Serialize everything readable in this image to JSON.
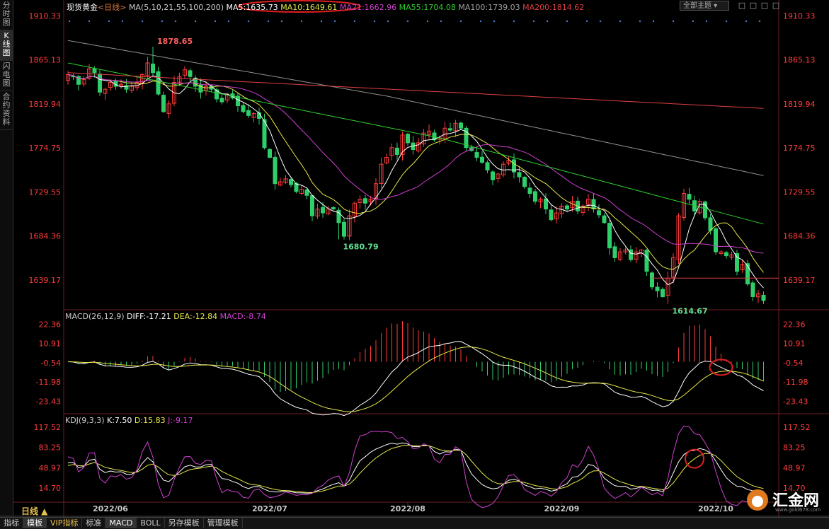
{
  "sidebar": {
    "tabs": [
      {
        "label": "分时图",
        "active": false
      },
      {
        "label": "K线图",
        "active": true
      },
      {
        "label": "闪电图",
        "active": false
      },
      {
        "label": "合约资料",
        "active": false
      }
    ]
  },
  "header": {
    "instrument": "现货黄金",
    "period": "<日线>",
    "ma_params": "MA(5,10,21,55,100,200)",
    "ma5": "MA5:1635.73",
    "ma10": "MA10:1649.61",
    "ma21": "MA21:1662.96",
    "ma55": "MA55:1704.08",
    "ma100": "MA100:1739.03",
    "ma200": "MA200:1814.62",
    "theme": "全部主题",
    "window_controls": [
      "□",
      "□",
      "□",
      "□"
    ]
  },
  "macd_header": {
    "name": "MACD(26,12,9)",
    "diff": "DIFF:-17.21",
    "dea": "DEA:-12.84",
    "macd": "MACD:-8.74"
  },
  "kdj_header": {
    "name": "KDJ(9,3,3)",
    "k": "K:7.50",
    "d": "D:15.83",
    "j": "J:-9.17"
  },
  "colors": {
    "up": "#ff3b3b",
    "down": "#2ecf6a",
    "ma5": "#ffffff",
    "ma10": "#e8e84a",
    "ma21": "#d040d0",
    "ma55": "#2ecf2e",
    "ma100": "#909090",
    "ma200": "#e04040",
    "axis_label": "#ff3b3b"
  },
  "bottom_bar": {
    "period_label": "日线 ▲",
    "tabs": [
      {
        "label": "指标",
        "active": false,
        "gold": false
      },
      {
        "label": "模板",
        "active": true,
        "gold": false
      },
      {
        "label": "VIP指标",
        "active": false,
        "gold": true
      },
      {
        "label": "标准",
        "active": false,
        "gold": false
      },
      {
        "label": "MACD",
        "active": true,
        "gold": false
      },
      {
        "label": "BOLL",
        "active": false,
        "gold": false
      },
      {
        "label": "另存模板",
        "active": false,
        "gold": false
      },
      {
        "label": "管理模板",
        "active": false,
        "gold": false
      }
    ]
  },
  "logo": {
    "text": "汇金网",
    "url": "www.gold678.com"
  },
  "chart_data": [
    {
      "type": "candlestick",
      "title": "现货黄金 日线",
      "yticks": [
        "1910.33",
        "1865.13",
        "1819.94",
        "1774.75",
        "1729.55",
        "1684.36",
        "1639.17"
      ],
      "ylim": [
        1610,
        1915
      ],
      "xticks": [
        "2022/06",
        "2022/07",
        "2022/08",
        "2022/09",
        "2022/10"
      ],
      "annotations": [
        {
          "text": "1878.65",
          "value": 1878.65
        },
        {
          "text": "1680.79",
          "value": 1680.79
        },
        {
          "text": "1614.67",
          "value": 1614.67
        }
      ],
      "horizontal_line": 1641,
      "closes": [
        1850,
        1848,
        1840,
        1845,
        1856,
        1852,
        1832,
        1835,
        1842,
        1838,
        1840,
        1835,
        1838,
        1842,
        1850,
        1862,
        1852,
        1830,
        1812,
        1820,
        1842,
        1848,
        1855,
        1848,
        1838,
        1832,
        1838,
        1835,
        1825,
        1822,
        1830,
        1826,
        1818,
        1812,
        1808,
        1810,
        1805,
        1775,
        1765,
        1738,
        1740,
        1743,
        1737,
        1730,
        1732,
        1726,
        1705,
        1712,
        1708,
        1712,
        1712,
        1698,
        1684,
        1705,
        1718,
        1722,
        1718,
        1722,
        1738,
        1758,
        1765,
        1775,
        1768,
        1788,
        1780,
        1773,
        1780,
        1790,
        1792,
        1783,
        1785,
        1795,
        1793,
        1800,
        1795,
        1775,
        1772,
        1765,
        1760,
        1752,
        1742,
        1748,
        1758,
        1762,
        1750,
        1745,
        1735,
        1728,
        1720,
        1722,
        1712,
        1701,
        1708,
        1715,
        1712,
        1720,
        1710,
        1715,
        1722,
        1712,
        1706,
        1698,
        1672,
        1662,
        1668,
        1670,
        1660,
        1668,
        1670,
        1648,
        1632,
        1628,
        1622,
        1641,
        1662,
        1705,
        1728,
        1722,
        1710,
        1720,
        1703,
        1690,
        1668,
        1668,
        1664,
        1665,
        1648,
        1655,
        1635,
        1622,
        1625,
        1618
      ]
    },
    {
      "type": "bar",
      "title": "MACD(26,12,9)",
      "yticks": [
        "22.36",
        "10.91",
        "-0.54",
        "-11.98",
        "-23.43"
      ],
      "ylim": [
        -30,
        25
      ],
      "diff_last": -17.21,
      "dea_last": -12.84,
      "macd_last": -8.74
    },
    {
      "type": "line",
      "title": "KDJ(9,3,3)",
      "yticks": [
        "117.52",
        "83.25",
        "48.97",
        "14.70"
      ],
      "ylim": [
        -12,
        125
      ],
      "k_last": 7.5,
      "d_last": 15.83,
      "j_last": -9.17
    }
  ]
}
